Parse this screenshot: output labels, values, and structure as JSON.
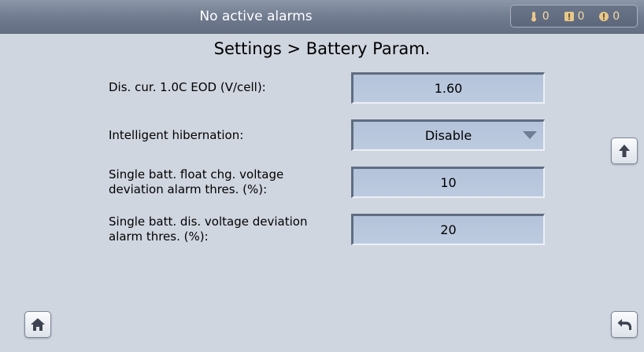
{
  "status_bar": {
    "alarm_text": "No active alarms",
    "critical_count": "0",
    "major_count": "0",
    "minor_count": "0"
  },
  "page_title": "Settings > Battery Param.",
  "fields": [
    {
      "label": "Dis. cur. 1.0C EOD (V/cell):",
      "value": "1.60"
    },
    {
      "label": "Intelligent hibernation:",
      "value": "Disable"
    },
    {
      "label": "Single batt. float chg. voltage deviation alarm thres. (%):",
      "value": "10"
    },
    {
      "label": "Single batt. dis. voltage deviation alarm thres. (%):",
      "value": "20"
    }
  ],
  "icons": {
    "scroll_up": "up-arrow-icon",
    "home": "home-icon",
    "back": "back-arrow-icon",
    "dropdown": "triangle-down-icon"
  },
  "colors": {
    "status_bar": "#6f7a8e",
    "background": "#d0d6e0",
    "field": "#b8c6dc",
    "alarm_count": "#f2d9a6"
  }
}
